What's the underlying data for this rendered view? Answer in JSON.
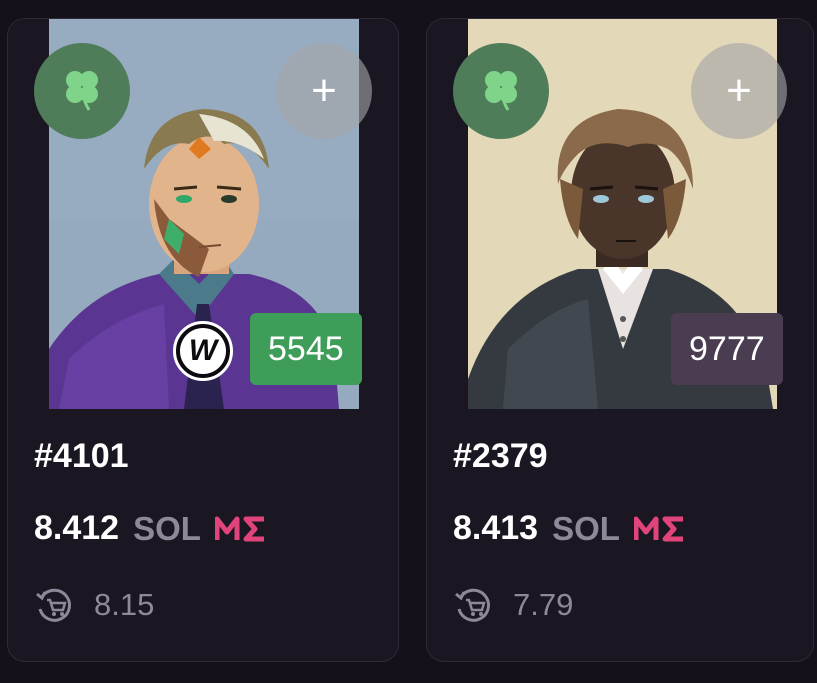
{
  "cards": [
    {
      "name": "#4101",
      "rank": "5545",
      "price": "8.412",
      "currency": "SOL",
      "last_sale": "8.15",
      "clover_icon": "clover-icon",
      "plus_label": "+",
      "marketplace": "ME",
      "has_wallet_badge": true,
      "badge_letter": "W",
      "rank_color": "#3f9d5a",
      "background_color": "#95a9bf"
    },
    {
      "name": "#2379",
      "rank": "9777",
      "price": "8.413",
      "currency": "SOL",
      "last_sale": "7.79",
      "clover_icon": "clover-icon",
      "plus_label": "+",
      "marketplace": "ME",
      "has_wallet_badge": false,
      "rank_color": "#4a3d52",
      "background_color": "#e9dfc2"
    }
  ],
  "colors": {
    "page_bg": "#14111a",
    "card_bg": "#1b1722",
    "muted_text": "#8e8898",
    "me_pink": "#e0447a",
    "clover_green": "#4f7d5a"
  }
}
